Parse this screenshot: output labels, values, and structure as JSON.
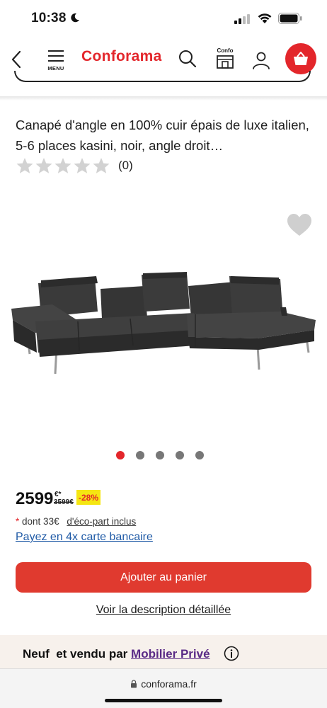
{
  "status_bar": {
    "time": "10:38"
  },
  "header": {
    "menu_label": "MENU",
    "logo_text": "Conforama",
    "confo_label": "Confo",
    "brand_color": "#e3262b"
  },
  "product": {
    "title": "Canapé d'angle en 100% cuir épais de luxe italien, 5-6 places kasini, noir, angle droit…",
    "rating_stars": 0,
    "rating_max": 5,
    "rating_count": "(0)",
    "image_alt": "sofa"
  },
  "carousel": {
    "total": 5,
    "active_index": 0
  },
  "pricing": {
    "price": "2599",
    "price_sup": "€*",
    "old_price": "3599€",
    "discount": "-28%",
    "eco_asterisk": "*",
    "eco_text": "dont 33€",
    "eco_link": "d'éco-part inclus",
    "payment_link": "Payez en 4x carte bancaire"
  },
  "actions": {
    "add_to_cart": "Ajouter au panier",
    "see_description": "Voir la description détaillée"
  },
  "seller": {
    "prefix": "Neuf  et vendu par",
    "name": "Mobilier Privé"
  },
  "browser": {
    "url": "conforama.fr"
  },
  "colors": {
    "accent": "#e3262b",
    "link_blue": "#1f5aa6",
    "seller_link": "#5a2a86",
    "discount_bg": "#f5e612"
  }
}
